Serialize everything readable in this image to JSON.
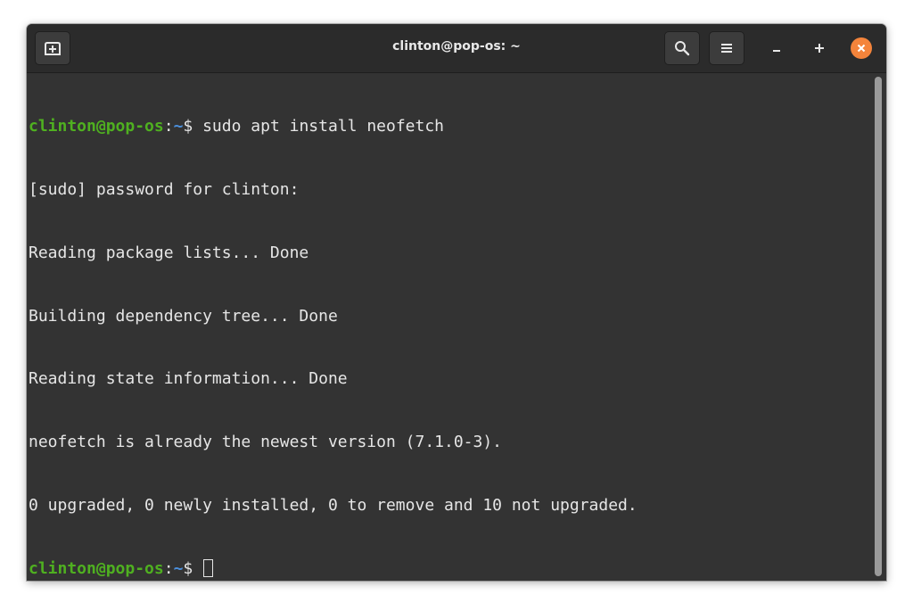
{
  "window": {
    "title": "clinton@pop-os: ~"
  },
  "toolbar": {
    "new_tab_icon": "new-tab-icon",
    "search_icon": "search-icon",
    "menu_icon": "hamburger-menu-icon",
    "minimize_label": "–",
    "maximize_label": "+",
    "close_icon": "close-icon"
  },
  "terminal": {
    "prompt": {
      "user_host": "clinton@pop-os",
      "colon": ":",
      "path": "~",
      "symbol": "$ "
    },
    "command": "sudo apt install neofetch",
    "output": [
      "[sudo] password for clinton:",
      "Reading package lists... Done",
      "Building dependency tree... Done",
      "Reading state information... Done",
      "neofetch is already the newest version (7.1.0-3).",
      "0 upgraded, 0 newly installed, 0 to remove and 10 not upgraded."
    ]
  },
  "colors": {
    "prompt_user": "#4fb020",
    "prompt_path": "#4b8fdc",
    "close_button": "#f4843b",
    "background": "#333333"
  }
}
